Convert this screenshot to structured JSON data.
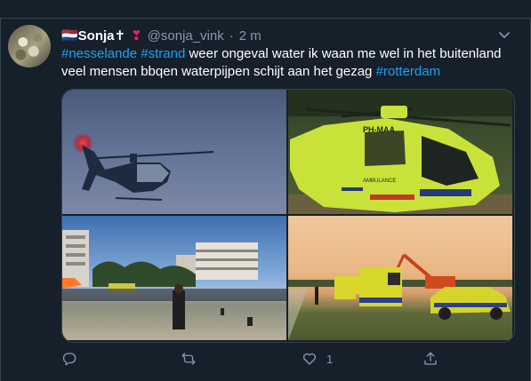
{
  "tweet": {
    "name": "🇳🇱Sonja✝",
    "heart": "❣",
    "handle": "@sonja_vink",
    "separator": "·",
    "time": "2 m",
    "text_segments": [
      {
        "text": "#nesselande",
        "kind": "hashtag"
      },
      {
        "text": " ",
        "kind": "text"
      },
      {
        "text": "#strand",
        "kind": "hashtag"
      },
      {
        "text": " weer ongeval water ik waan me wel in het buitenland veel mensen bbqen waterpijpen schijt aan het gezag ",
        "kind": "text"
      },
      {
        "text": "#rotterdam",
        "kind": "hashtag"
      }
    ],
    "photo_text": {
      "registration": "PH-MAA",
      "ambulance_label": "AMBULANCE"
    },
    "actions": {
      "reply_icon": "reply-icon",
      "retweet_icon": "retweet-icon",
      "like_icon": "heart-icon",
      "like_count": "1",
      "share_icon": "share-icon"
    }
  },
  "colors": {
    "background": "#15202b",
    "text": "#ffffff",
    "secondary": "#8899a6",
    "link": "#1da1f2",
    "border": "#38444d"
  }
}
